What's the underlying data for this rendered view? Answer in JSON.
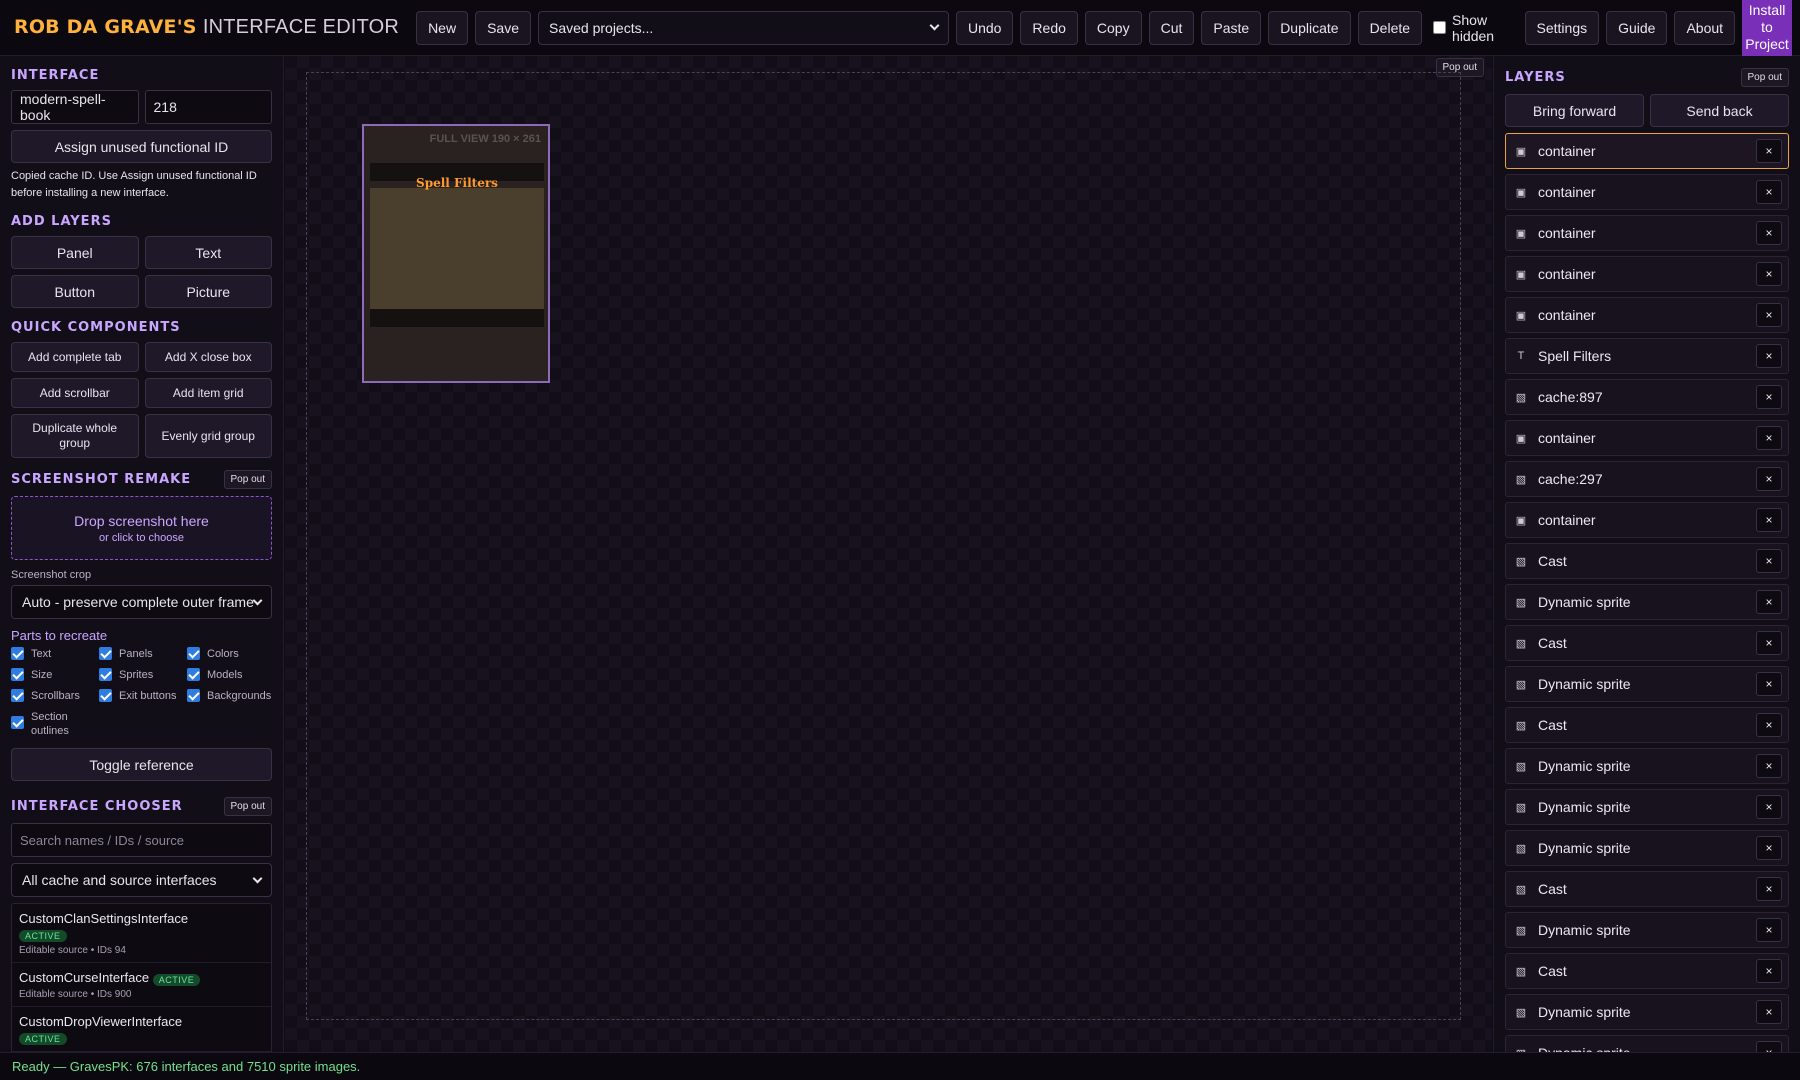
{
  "brand": {
    "part1": "ROB DA GRAVE'S",
    "part2": "INTERFACE EDITOR"
  },
  "toolbar": {
    "new": "New",
    "save": "Save",
    "projects_select": "Saved projects...",
    "undo": "Undo",
    "redo": "Redo",
    "copy": "Copy",
    "cut": "Cut",
    "paste": "Paste",
    "duplicate": "Duplicate",
    "delete": "Delete",
    "show_hidden": "Show hidden",
    "settings": "Settings",
    "guide": "Guide",
    "about": "About",
    "install": "Install to Project"
  },
  "interface": {
    "title": "INTERFACE",
    "name_value": "modern-spell-book",
    "id_value": "218",
    "assign_button": "Assign unused functional ID",
    "note": "Copied cache ID. Use Assign unused functional ID before installing a new interface."
  },
  "add_layers": {
    "title": "ADD LAYERS",
    "panel": "Panel",
    "text": "Text",
    "button": "Button",
    "picture": "Picture"
  },
  "quick_components": {
    "title": "QUICK COMPONENTS",
    "complete_tab": "Add complete tab",
    "close_box": "Add X close box",
    "scrollbar": "Add scrollbar",
    "item_grid": "Add item grid",
    "duplicate_group": "Duplicate whole group",
    "evenly_grid": "Evenly grid group"
  },
  "screenshot_remake": {
    "title": "SCREENSHOT REMAKE",
    "pop_out": "Pop out",
    "drop_main": "Drop screenshot here",
    "drop_sub": "or click to choose",
    "crop_label": "Screenshot crop",
    "crop_value": "Auto - preserve complete outer frame",
    "parts_label": "Parts to recreate",
    "parts": [
      "Text",
      "Panels",
      "Colors",
      "Size",
      "Sprites",
      "Models",
      "Scrollbars",
      "Exit buttons",
      "Backgrounds",
      "Section outlines"
    ],
    "toggle_reference": "Toggle reference"
  },
  "interface_chooser": {
    "title": "INTERFACE CHOOSER",
    "pop_out": "Pop out",
    "search_placeholder": "Search names / IDs / source",
    "filter_value": "All cache and source interfaces",
    "items": [
      {
        "name": "CustomClanSettingsInterface",
        "badge": "ACTIVE",
        "meta": "Editable source • IDs 94"
      },
      {
        "name": "CustomCurseInterface",
        "badge": "ACTIVE",
        "meta": "Editable source • IDs 900"
      },
      {
        "name": "CustomDropViewerInterface",
        "badge": "ACTIVE",
        "meta": ""
      }
    ]
  },
  "canvas": {
    "pop_out": "Pop out",
    "full_view": "FULL VIEW 190 × 261",
    "preview_title": "Spell Filters"
  },
  "layers_panel": {
    "title": "LAYERS",
    "pop_out": "Pop out",
    "bring_forward": "Bring forward",
    "send_back": "Send back",
    "items": [
      {
        "icon": "▣",
        "name": "container",
        "selected": true
      },
      {
        "icon": "▣",
        "name": "container"
      },
      {
        "icon": "▣",
        "name": "container"
      },
      {
        "icon": "▣",
        "name": "container"
      },
      {
        "icon": "▣",
        "name": "container"
      },
      {
        "icon": "T",
        "name": "Spell Filters"
      },
      {
        "icon": "▧",
        "name": "cache:897"
      },
      {
        "icon": "▣",
        "name": "container"
      },
      {
        "icon": "▧",
        "name": "cache:297"
      },
      {
        "icon": "▣",
        "name": "container"
      },
      {
        "icon": "▧",
        "name": "Cast"
      },
      {
        "icon": "▧",
        "name": "Dynamic sprite"
      },
      {
        "icon": "▧",
        "name": "Cast"
      },
      {
        "icon": "▧",
        "name": "Dynamic sprite"
      },
      {
        "icon": "▧",
        "name": "Cast"
      },
      {
        "icon": "▧",
        "name": "Dynamic sprite"
      },
      {
        "icon": "▧",
        "name": "Dynamic sprite"
      },
      {
        "icon": "▧",
        "name": "Dynamic sprite"
      },
      {
        "icon": "▧",
        "name": "Cast"
      },
      {
        "icon": "▧",
        "name": "Dynamic sprite"
      },
      {
        "icon": "▧",
        "name": "Cast"
      },
      {
        "icon": "▧",
        "name": "Dynamic sprite"
      },
      {
        "icon": "▧",
        "name": "Dynamic sprite"
      }
    ],
    "remove_glyph": "×"
  },
  "status": "Ready — GravesPK: 676 interfaces and 7510 sprite images.",
  "colors": {
    "accent": "#c9a6ff",
    "brand_orange": "#ffb13d",
    "install_bg": "#7a2fb8",
    "status_green": "#73e08d",
    "selected_border": "#e8a33a"
  }
}
